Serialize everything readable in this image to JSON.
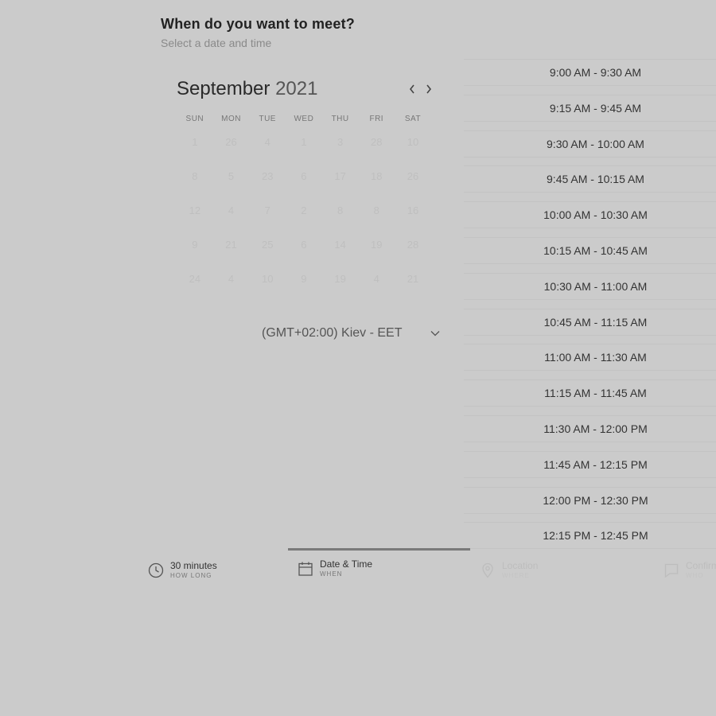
{
  "header": {
    "title": "When do you want to meet?",
    "subtitle": "Select a date and time"
  },
  "calendar": {
    "month": "September",
    "year": "2021",
    "prev_icon": "chevron-left-icon",
    "next_icon": "chevron-right-icon",
    "weekdays": [
      "SUN",
      "MON",
      "TUE",
      "WED",
      "THU",
      "FRI",
      "SAT"
    ],
    "weeks": [
      [
        "1",
        "26",
        "4",
        "1",
        "3",
        "28",
        "10"
      ],
      [
        "8",
        "5",
        "23",
        "6",
        "17",
        "18",
        "26"
      ],
      [
        "12",
        "4",
        "7",
        "2",
        "8",
        "8",
        "16"
      ],
      [
        "9",
        "21",
        "25",
        "6",
        "14",
        "19",
        "28"
      ],
      [
        "24",
        "4",
        "10",
        "9",
        "19",
        "4",
        "21"
      ]
    ]
  },
  "timezone": {
    "label": "(GMT+02:00) Kiev - EET",
    "icon": "chevron-down-icon"
  },
  "slots": [
    "9:00 AM - 9:30 AM",
    "9:15 AM - 9:45 AM",
    "9:30 AM - 10:00 AM",
    "9:45 AM - 10:15 AM",
    "10:00 AM - 10:30 AM",
    "10:15 AM - 10:45 AM",
    "10:30 AM - 11:00 AM",
    "10:45 AM - 11:15 AM",
    "11:00 AM - 11:30 AM",
    "11:15 AM - 11:45 AM",
    "11:30 AM - 12:00 PM",
    "11:45 AM - 12:15 PM",
    "12:00 PM - 12:30 PM",
    "12:15 PM - 12:45 PM"
  ],
  "steps": [
    {
      "label": "30 minutes",
      "sub": "HOW LONG",
      "icon": "clock-icon"
    },
    {
      "label": "Date & Time",
      "sub": "WHEN",
      "icon": "calendar-icon"
    },
    {
      "label": "Location",
      "sub": "WHERE",
      "icon": "location-pin-icon"
    },
    {
      "label": "Confirm",
      "sub": "WHO",
      "icon": "chat-icon"
    }
  ],
  "colors": {
    "background": "#cbcbcb",
    "active_underline": "#7a7a7a"
  }
}
